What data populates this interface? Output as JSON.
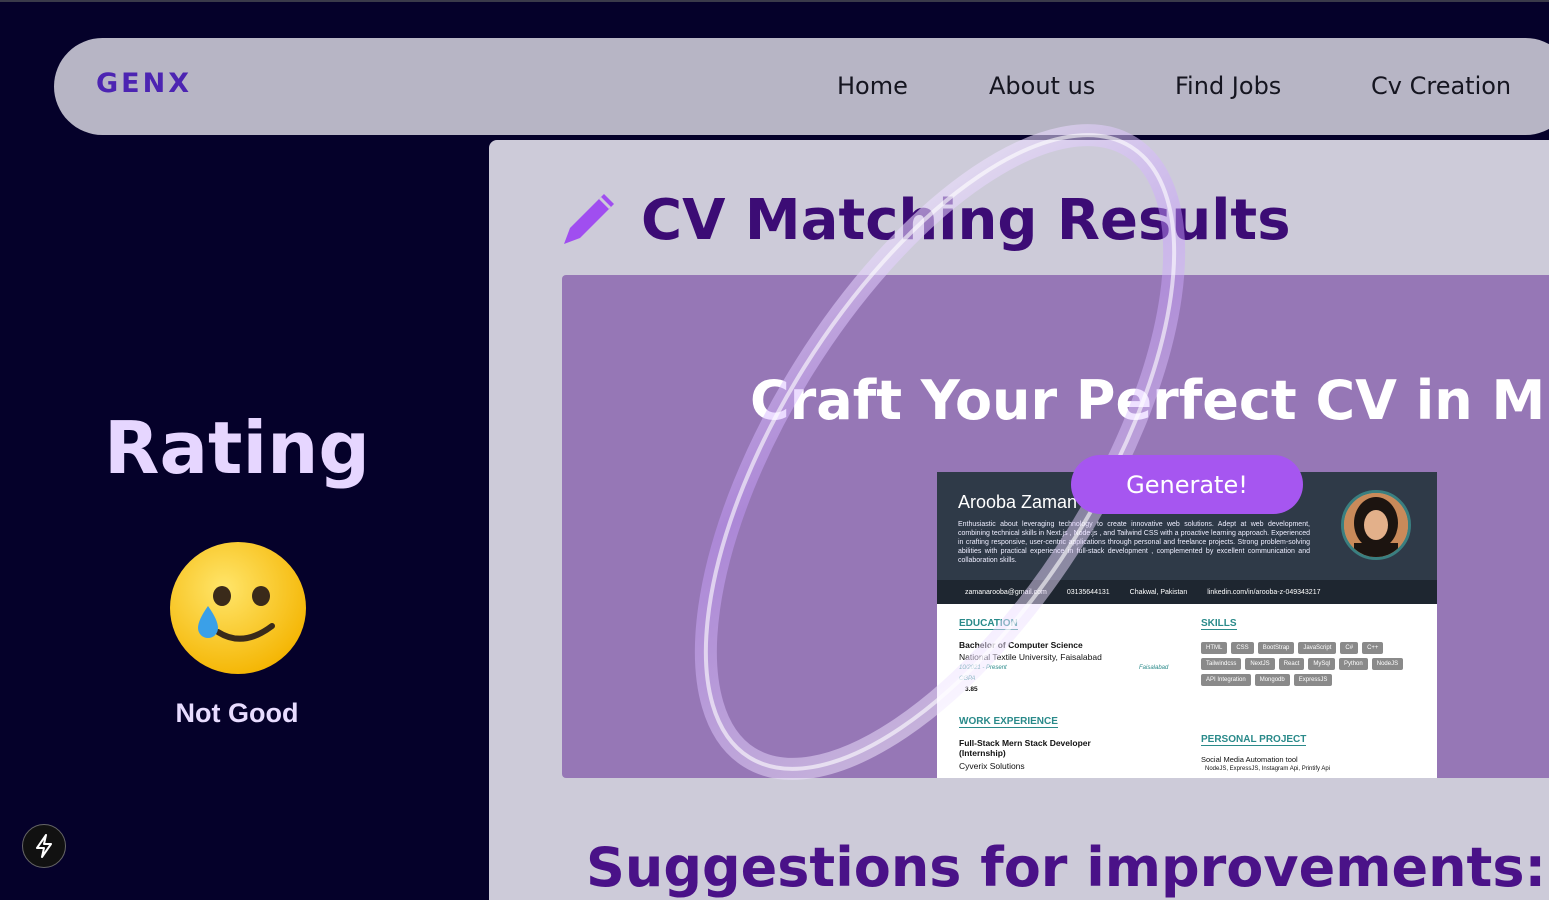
{
  "nav": {
    "logo": "GENX",
    "links": [
      "Home",
      "About us",
      "Find Jobs",
      "Cv Creation"
    ]
  },
  "rating": {
    "title": "Rating",
    "emoji": "🥲",
    "label": "Not Good"
  },
  "results": {
    "title": "CV Matching Results",
    "icon": "pencil-icon"
  },
  "banner": {
    "heading": "Craft Your Perfect CV in Minute",
    "button": "Generate!"
  },
  "cv": {
    "name": "Arooba Zaman",
    "summary": "Enthusiastic about leveraging technology to create innovative web solutions. Adept at web development, combining technical skills in Next.js , Node.js , and Tailwind CSS with a proactive learning approach. Experienced in crafting responsive, user-centric applications through personal and freelance projects. Strong problem-solving abilities with practical experience in full-stack development , complemented by excellent communication and collaboration skills.",
    "email": "zamanarooba@gmail.com",
    "phone": "03135644131",
    "location": "Chakwal, Pakistan",
    "linkedin": "linkedin.com/in/arooba-z-049343217",
    "education_heading": "EDUCATION",
    "degree": "Bachelor of Computer Science",
    "university": "National Textile University, Faisalabad",
    "edu_dates": "10/2021 - Present",
    "edu_city": "Faisalabad",
    "cgpa_label": "CGPA",
    "cgpa": "3.85",
    "work_heading": "WORK EXPERIENCE",
    "job_title": "Full-Stack Mern Stack Developer (Internship)",
    "company": "Cyverix Solutions",
    "skills_heading": "SKILLS",
    "skills": [
      "HTML",
      "CSS",
      "BootStrap",
      "JavaScript",
      "C#",
      "C++",
      "Tailwindcss",
      "NextJS",
      "React",
      "MySql",
      "Python",
      "NodeJS",
      "API Integration",
      "Mongodb",
      "ExpressJS"
    ],
    "project_heading": "PERSONAL PROJECT",
    "project_title": "Social Media Automation tool",
    "project_stack": "NodeJS, ExpressJS, Instagram Api, Printify Api"
  },
  "suggestions": {
    "title": "Suggestions for improvements:"
  },
  "colors": {
    "background": "#05012a",
    "navbar": "#b7b5c5",
    "accent": "#a656f0",
    "title": "#3c0c75"
  }
}
